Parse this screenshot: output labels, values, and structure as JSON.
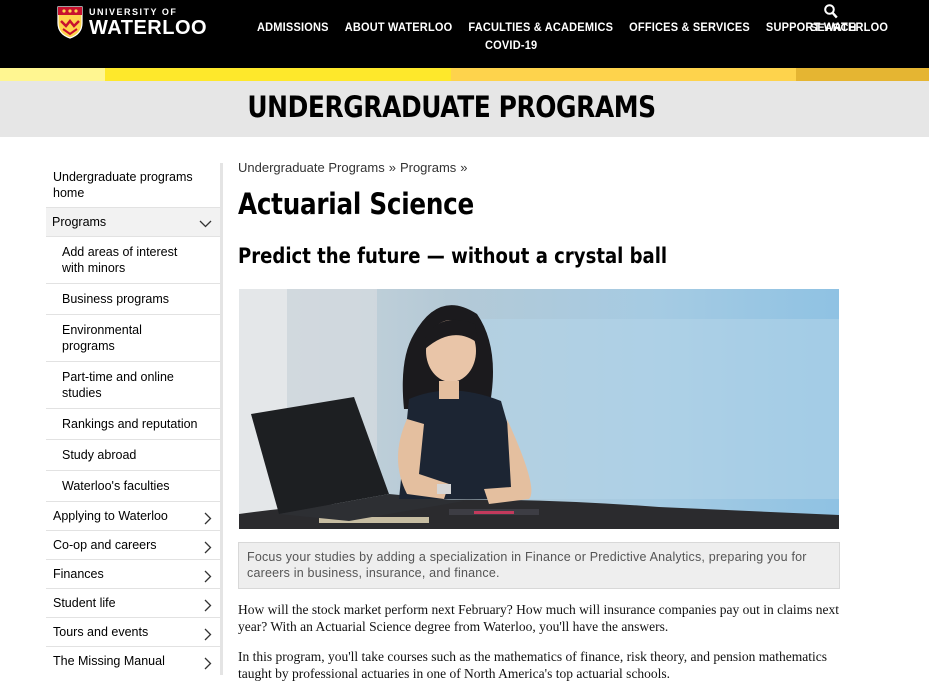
{
  "header": {
    "logo_top": "UNIVERSITY OF",
    "logo_bottom": "WATERLOO",
    "nav": [
      "ADMISSIONS",
      "ABOUT WATERLOO",
      "FACULTIES & ACADEMICS",
      "OFFICES & SERVICES",
      "SUPPORT WATERLOO"
    ],
    "nav_second_row": "COVID-19",
    "search_label": "SEARCH",
    "icons": {
      "search": "search-icon",
      "logo": "crest-icon"
    }
  },
  "colors": {
    "header_bg": "#000000",
    "stripe": [
      "#fff691",
      "#fee82b",
      "#fed34c",
      "#e5b532"
    ],
    "banner_bg": "#e6e6e6"
  },
  "banner": {
    "title": "UNDERGRADUATE PROGRAMS"
  },
  "sidebar": {
    "home": "Undergraduate programs home",
    "programs": "Programs",
    "sub_items": [
      "Add areas of interest with minors",
      "Business programs",
      "Environmental programs",
      "Part-time and online studies",
      "Rankings and reputation",
      "Study abroad",
      "Waterloo's faculties"
    ],
    "sections": [
      "Applying to Waterloo",
      "Co-op and careers",
      "Finances",
      "Student life",
      "Tours and events",
      "The Missing Manual"
    ],
    "icons": {
      "expanded": "chevron-down-icon",
      "collapsed": "chevron-right-icon"
    }
  },
  "main": {
    "breadcrumb": [
      "Undergraduate Programs",
      "»",
      "Programs",
      "»"
    ],
    "title": "Actuarial Science",
    "subtitle": "Predict the future — without a crystal ball",
    "caption": "Focus your studies by adding a specialization in Finance or Predictive Analytics, preparing you for careers in business, insurance, and finance.",
    "paragraphs": [
      "How will the stock market perform next February? How much will insurance companies pay out in claims next year? With an Actuarial Science degree from Waterloo, you'll have the answers.",
      "In this program, you'll take courses such as the mathematics of finance, risk theory, and pension mathematics taught by professional actuaries in one of North America's top actuarial schools."
    ]
  }
}
